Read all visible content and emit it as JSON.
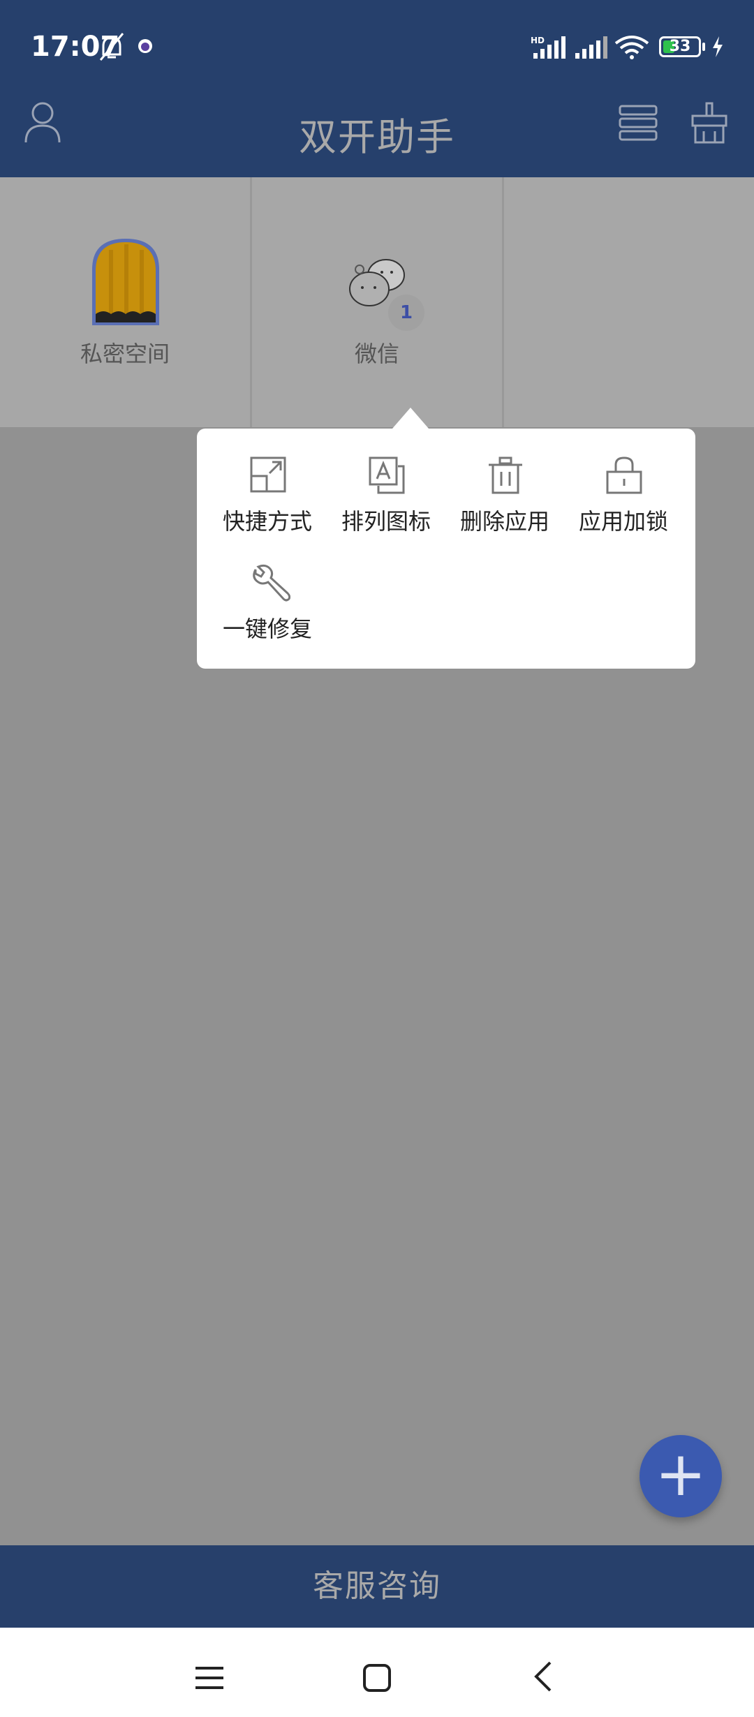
{
  "status_bar": {
    "time": "17:07",
    "battery_level": "33",
    "network_label": "HD",
    "icons": [
      "mute-bell-icon",
      "app-notification-icon",
      "signal-icon",
      "signal-icon",
      "wifi-icon",
      "battery-icon",
      "charging-icon"
    ]
  },
  "header": {
    "title": "双开助手",
    "icons": [
      "user-icon",
      "list-icon",
      "clean-icon"
    ]
  },
  "apps": [
    {
      "label": "私密空间",
      "icon": "curtain-icon"
    },
    {
      "label": "微信",
      "icon": "wechat-cat-icon",
      "badge": "1"
    }
  ],
  "context_menu": {
    "items": [
      {
        "label": "快捷方式",
        "icon": "shortcut-icon"
      },
      {
        "label": "排列图标",
        "icon": "arrange-icon"
      },
      {
        "label": "删除应用",
        "icon": "trash-icon"
      },
      {
        "label": "应用加锁",
        "icon": "lock-icon"
      },
      {
        "label": "一键修复",
        "icon": "wrench-icon"
      }
    ]
  },
  "fab": {
    "label": "+"
  },
  "bottom_bar": {
    "label": "客服咨询"
  },
  "nav": {
    "icons": [
      "menu-icon",
      "home-icon",
      "back-icon"
    ]
  },
  "colors": {
    "header_bg": "#26406c",
    "overlay_bg": "#919191",
    "fab_bg": "#3b5ab0",
    "battery_fill": "#2fc14d"
  }
}
